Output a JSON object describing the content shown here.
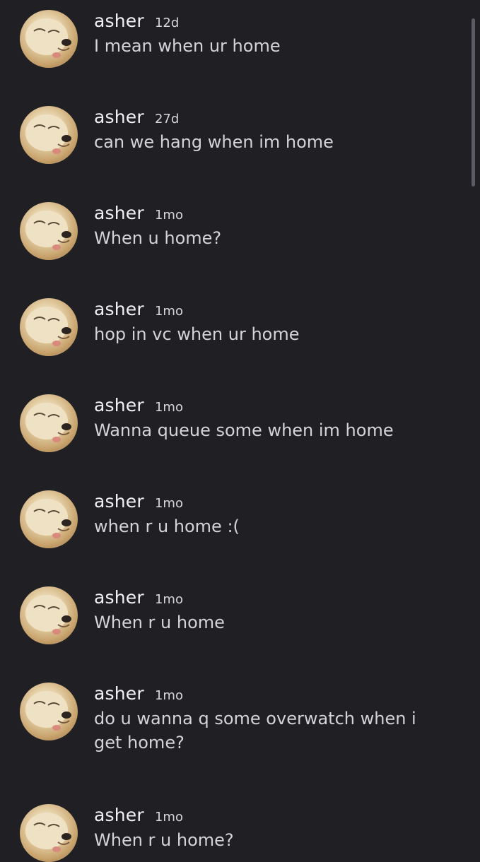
{
  "messages": [
    {
      "author": "asher",
      "time": "12d",
      "text": "I mean when ur home"
    },
    {
      "author": "asher",
      "time": "27d",
      "text": "can we hang when im home"
    },
    {
      "author": "asher",
      "time": "1mo",
      "text": "When u home?"
    },
    {
      "author": "asher",
      "time": "1mo",
      "text": "hop in vc when ur home"
    },
    {
      "author": "asher",
      "time": "1mo",
      "text": "Wanna queue some when im home"
    },
    {
      "author": "asher",
      "time": "1mo",
      "text": "when r u home :("
    },
    {
      "author": "asher",
      "time": "1mo",
      "text": "When r u home"
    },
    {
      "author": "asher",
      "time": "1mo",
      "text": "do u wanna q some overwatch when i get home?"
    },
    {
      "author": "asher",
      "time": "1mo",
      "text": "When r u home?"
    }
  ],
  "avatar_icon": "dog-avatar-icon",
  "colors": {
    "background": "#1f1f24",
    "name": "#f2f2f5",
    "text": "#d3d3d9",
    "scrollbar": "#5b5b63"
  }
}
